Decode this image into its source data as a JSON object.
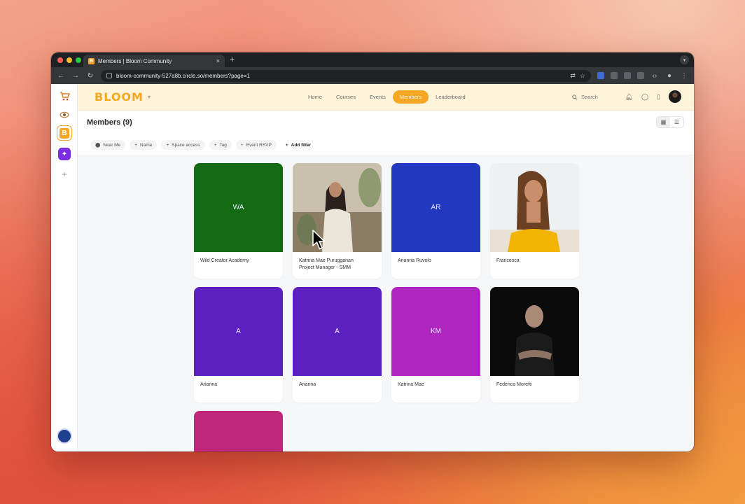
{
  "browser": {
    "tab_title": "Members | Bloom Community",
    "tab_favicon": "B",
    "tab_close": "×",
    "new_tab": "+",
    "url": "bloom-community-527a8b.circle.so/members?page=1",
    "colors": {
      "red": "#ff5f57",
      "yellow": "#febc2e",
      "green": "#28c840"
    }
  },
  "app": {
    "logo": "BLOOM",
    "nav": [
      {
        "label": "Home",
        "active": false
      },
      {
        "label": "Courses",
        "active": false
      },
      {
        "label": "Events",
        "active": false
      },
      {
        "label": "Members",
        "active": true
      },
      {
        "label": "Leaderboard",
        "active": false
      }
    ],
    "search_label": "Search",
    "accent": "#f5a623"
  },
  "page": {
    "title": "Members (9)",
    "filters": [
      {
        "icon": "location-pin-icon",
        "label": "Near Me"
      },
      {
        "icon": "plus-icon",
        "label": "Name"
      },
      {
        "icon": "plus-icon",
        "label": "Space access"
      },
      {
        "icon": "plus-icon",
        "label": "Tag"
      },
      {
        "icon": "plus-icon",
        "label": "Event RSVP"
      }
    ],
    "add_filter": "Add filter"
  },
  "members": [
    {
      "name": "Wild Creator Academy",
      "initials": "WA",
      "color": "#156a14",
      "photo": ""
    },
    {
      "name": "Katrina Mae Purugganan\nProject Manager - SMM",
      "initials": "",
      "color": "",
      "photo": "woman-outdoor"
    },
    {
      "name": "Arianna Ruvolo",
      "initials": "AR",
      "color": "#2338c0",
      "photo": ""
    },
    {
      "name": "Francesca",
      "initials": "",
      "color": "",
      "photo": "woman-beach"
    },
    {
      "name": "Arianna",
      "initials": "A",
      "color": "#5b21c0",
      "photo": ""
    },
    {
      "name": "Arianna",
      "initials": "A",
      "color": "#5b21c0",
      "photo": ""
    },
    {
      "name": "Katrina Mae",
      "initials": "KM",
      "color": "#ae25bf",
      "photo": ""
    },
    {
      "name": "Federico Moretti",
      "initials": "",
      "color": "",
      "photo": "man-dark"
    },
    {
      "name": "",
      "initials": "",
      "color": "#c0267a",
      "photo": ""
    }
  ]
}
